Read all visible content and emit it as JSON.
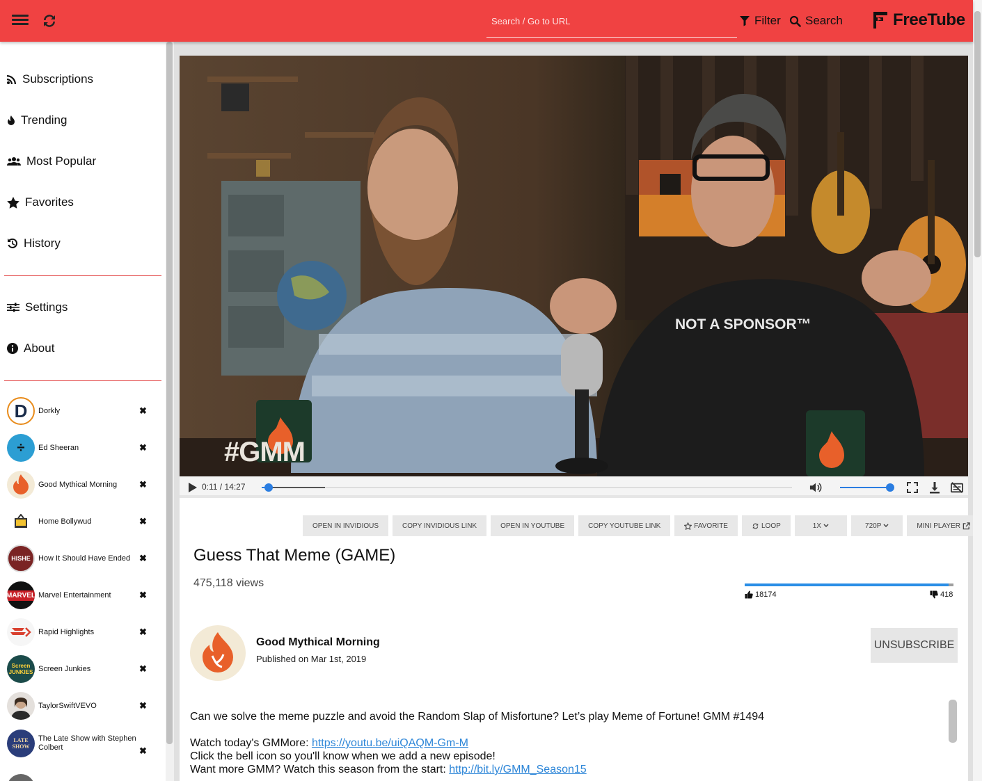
{
  "app": {
    "name": "FreeTube",
    "accent": "#f04242"
  },
  "search": {
    "placeholder": "Search / Go to URL",
    "filter_label": "Filter",
    "search_label": "Search"
  },
  "sidebar": {
    "nav": [
      {
        "label": "Subscriptions",
        "icon": "rss-icon"
      },
      {
        "label": "Trending",
        "icon": "fire-icon"
      },
      {
        "label": "Most Popular",
        "icon": "users-icon"
      },
      {
        "label": "Favorites",
        "icon": "star-icon"
      },
      {
        "label": "History",
        "icon": "history-icon"
      }
    ],
    "settings": [
      {
        "label": "Settings",
        "icon": "sliders-icon"
      },
      {
        "label": "About",
        "icon": "info-icon"
      }
    ],
    "subscriptions": [
      {
        "name": "Dorkly",
        "color": "#e88b1a"
      },
      {
        "name": "Ed Sheeran",
        "color": "#2c9ed3"
      },
      {
        "name": "Good Mythical Morning",
        "color": "#e8602a"
      },
      {
        "name": "Home Bollywud",
        "color": "#f2c230"
      },
      {
        "name": "How It Should Have Ended",
        "color": "#7a2424"
      },
      {
        "name": "Marvel Entertainment",
        "color": "#c81f26"
      },
      {
        "name": "Rapid Highlights",
        "color": "#d9402f"
      },
      {
        "name": "Screen Junkies",
        "color": "#18b1a5"
      },
      {
        "name": "TaylorSwiftVEVO",
        "color": "#9b9b9b"
      },
      {
        "name": "The Late Show with Stephen Colbert",
        "color": "#2a3d7a"
      }
    ]
  },
  "player": {
    "current_time": "0:11",
    "duration": "14:27",
    "time_display": "0:11 / 14:27",
    "progress_fraction": 0.013,
    "buffered_fraction": 0.12,
    "volume_fraction": 1.0,
    "overlay_tag": "#GMM",
    "shirt_text": "NOT A SPONSOR™"
  },
  "actions": [
    {
      "label": "OPEN IN INVIDIOUS",
      "icon": ""
    },
    {
      "label": "COPY INVIDIOUS LINK",
      "icon": ""
    },
    {
      "label": "OPEN IN YOUTUBE",
      "icon": ""
    },
    {
      "label": "COPY YOUTUBE LINK",
      "icon": ""
    },
    {
      "label": "FAVORITE",
      "icon": "star-outline-icon"
    },
    {
      "label": "LOOP",
      "icon": "loop-icon"
    },
    {
      "label": "1x",
      "icon": "chevron-down-icon"
    },
    {
      "label": "720p",
      "icon": "chevron-down-icon"
    },
    {
      "label": "MINI PLAYER",
      "icon": "external-link-icon"
    }
  ],
  "video": {
    "title": "Guess That Meme (GAME)",
    "views": "475,118 views",
    "likes": "18174",
    "dislikes": "418",
    "like_fraction": 0.9775
  },
  "channel": {
    "name": "Good Mythical Morning",
    "published": "Published on Mar 1st, 2019",
    "unsubscribe_label": "UNSUBSCRIBE"
  },
  "description": {
    "line1": "Can we solve the meme puzzle and avoid the Random Slap of Misfortune? Let’s play Meme of Fortune! GMM #1494",
    "line2_prefix": "Watch today's GMMore: ",
    "line2_link": "https://youtu.be/uiQAQM-Gm-M",
    "line3": "Click the bell icon so you'll know when we add a new episode!",
    "line4_prefix": "Want more GMM? Watch this season from the start: ",
    "line4_link": "http://bit.ly/GMM_Season15"
  }
}
